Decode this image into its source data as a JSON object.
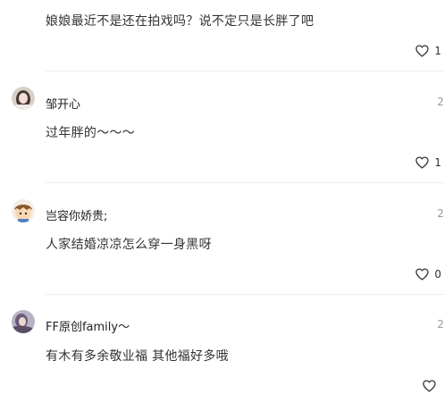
{
  "comments": [
    {
      "username": "",
      "text": "娘娘最近不是还在拍戏吗？说不定只是长胖了吧",
      "time": "",
      "likes": "1",
      "like_icon": "heart-outline-icon"
    },
    {
      "username": "邹开心",
      "text": "过年胖的～～～",
      "time": "2",
      "likes": "1",
      "like_icon": "heart-outline-icon"
    },
    {
      "username": "岂容你娇贵;",
      "text": "人家结婚凉凉怎么穿一身黑呀",
      "time": "2",
      "likes": "0",
      "like_icon": "heart-outline-icon"
    },
    {
      "username": "FF原创family～",
      "text": "有木有多余敬业福 其他福好多哦",
      "time": "2",
      "likes": "",
      "like_icon": "heart-outline-icon"
    }
  ],
  "colors": {
    "divider": "#ececec",
    "text": "#333333",
    "muted": "#9a9a9a"
  }
}
